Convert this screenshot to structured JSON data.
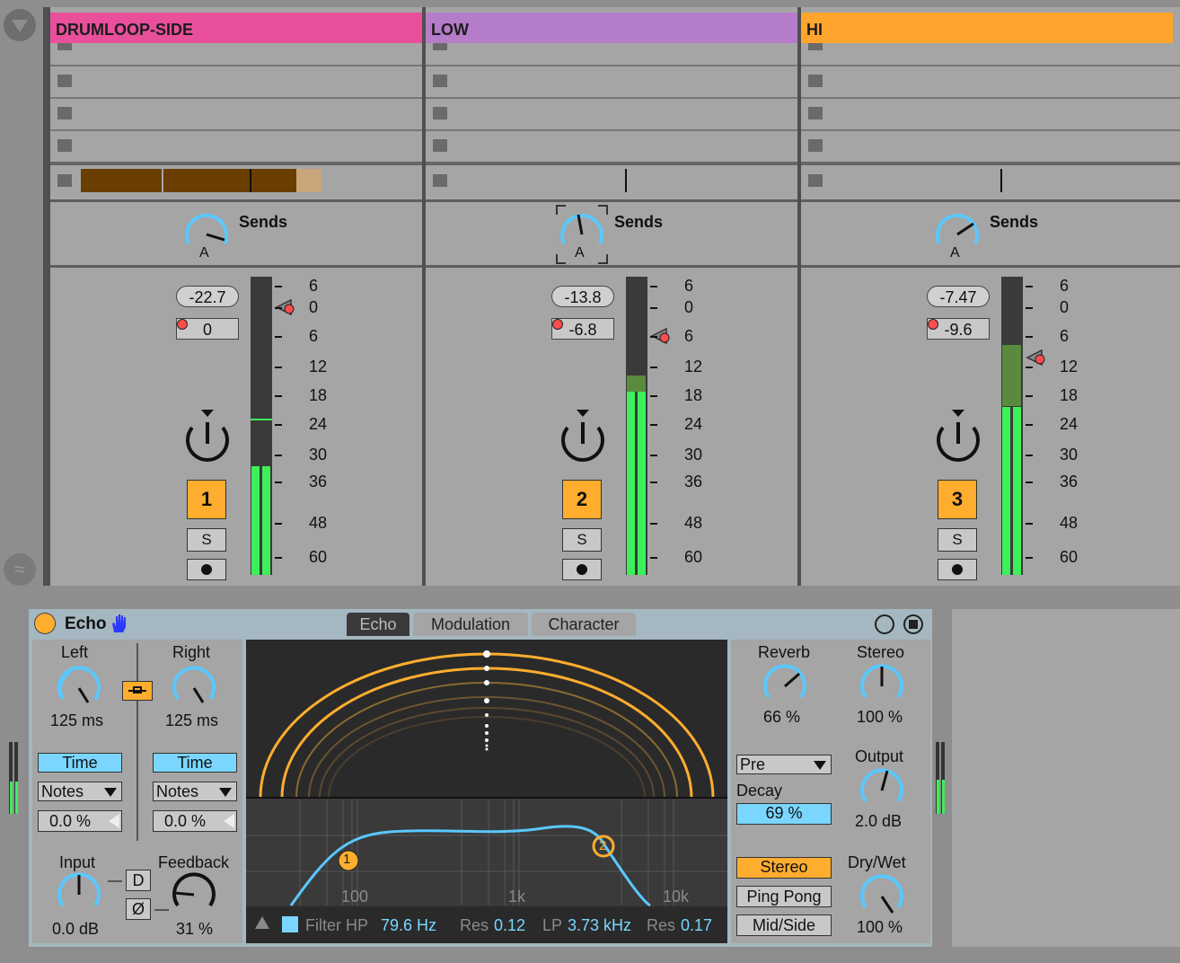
{
  "tracks": [
    {
      "name": "DRUMLOOP-SIDE",
      "color": "#e94f9b",
      "sends_label": "Sends",
      "send_knob_label": "A",
      "volume": "-22.7",
      "peak": "0",
      "track_number": "1",
      "solo_label": "S",
      "meter_level": 0.36
    },
    {
      "name": "LOW",
      "color": "#b57cc9",
      "sends_label": "Sends",
      "send_knob_label": "A",
      "volume": "-13.8",
      "peak": "-6.8",
      "track_number": "2",
      "solo_label": "S",
      "meter_level": 0.61
    },
    {
      "name": "HI",
      "color": "#ffa52e",
      "sends_label": "Sends",
      "send_knob_label": "A",
      "volume": "-7.47",
      "peak": "-9.6",
      "track_number": "3",
      "solo_label": "S",
      "meter_level": 0.56
    }
  ],
  "meter_scale": [
    "6",
    "0",
    "6",
    "12",
    "18",
    "24",
    "30",
    "36",
    "48",
    "60"
  ],
  "device": {
    "name": "Echo",
    "tabs": [
      "Echo",
      "Modulation",
      "Character"
    ],
    "left_label": "Left",
    "right_label": "Right",
    "left_value": "125 ms",
    "right_value": "125 ms",
    "time_label": "Time",
    "notes_label": "Notes",
    "left_offset": "0.0 %",
    "right_offset": "0.0 %",
    "input_label": "Input",
    "input_value": "0.0 dB",
    "feedback_label": "Feedback",
    "feedback_value": "31 %",
    "d_label": "D",
    "phase_label": "Ø",
    "reverb_label": "Reverb",
    "reverb_value": "66 %",
    "stereo_label": "Stereo",
    "stereo_value": "100 %",
    "pre_label": "Pre",
    "decay_label": "Decay",
    "decay_value": "69 %",
    "output_label": "Output",
    "output_value": "2.0 dB",
    "mode_stereo": "Stereo",
    "mode_pingpong": "Ping Pong",
    "mode_midside": "Mid/Side",
    "drywet_label": "Dry/Wet",
    "drywet_value": "100 %",
    "freq_labels": [
      "100",
      "1k",
      "10k"
    ],
    "filter_label": "Filter HP",
    "hp_value": "79.6 Hz",
    "res_label": "Res",
    "hp_res_value": "0.12",
    "lp_label": "LP",
    "lp_value": "3.73 kHz",
    "lp_res_value": "0.17",
    "point1": "1",
    "point2": "2"
  }
}
